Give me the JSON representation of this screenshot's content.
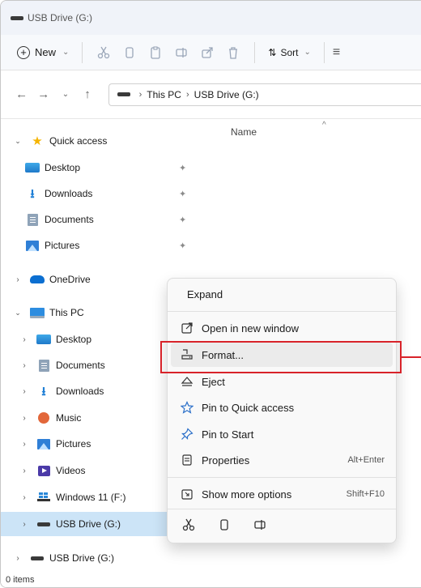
{
  "window": {
    "title": "USB Drive (G:)"
  },
  "toolbar": {
    "new_label": "New",
    "sort_label": "Sort",
    "icons": [
      "cut-icon",
      "copy-icon",
      "paste-icon",
      "rename-icon",
      "share-icon",
      "delete-icon"
    ]
  },
  "address": {
    "crumbs": [
      "This PC",
      "USB Drive (G:)"
    ]
  },
  "nav": {
    "quick_access": "Quick access",
    "qa_items": [
      "Desktop",
      "Downloads",
      "Documents",
      "Pictures"
    ],
    "onedrive": "OneDrive",
    "this_pc": "This PC",
    "pc_items": [
      "Desktop",
      "Documents",
      "Downloads",
      "Music",
      "Pictures",
      "Videos",
      "Windows 11 (F:)",
      "USB Drive (G:)"
    ],
    "usb_root": "USB Drive (G:)"
  },
  "content": {
    "column_name": "Name"
  },
  "status": {
    "items": "0 items"
  },
  "context_menu": {
    "expand": "Expand",
    "open_new_window": "Open in new window",
    "format": "Format...",
    "eject": "Eject",
    "pin_quick_access": "Pin to Quick access",
    "pin_start": "Pin to Start",
    "properties": "Properties",
    "properties_shortcut": "Alt+Enter",
    "show_more": "Show more options",
    "show_more_shortcut": "Shift+F10"
  },
  "colors": {
    "highlight": "#d8232a",
    "selected": "#cce4f7",
    "accent": "#2a6fc9"
  }
}
